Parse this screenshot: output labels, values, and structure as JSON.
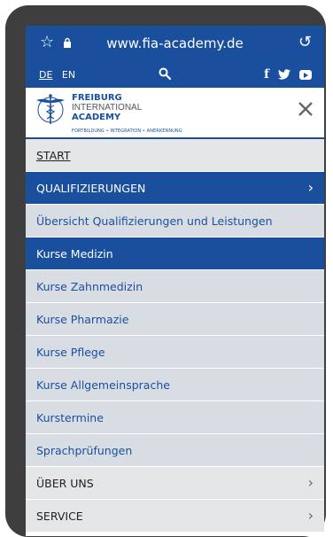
{
  "browser": {
    "url": "www.fia-academy.de",
    "star_icon": "star-icon",
    "lock_icon": "lock-icon",
    "reload_icon": "reload-icon"
  },
  "topnav": {
    "languages": [
      {
        "label": "DE",
        "active": true
      },
      {
        "label": "EN",
        "active": false
      }
    ],
    "search_icon": "search-icon",
    "social": [
      "facebook-icon",
      "twitter-icon",
      "youtube-icon"
    ]
  },
  "logo": {
    "line1": "FREIBURG",
    "line2": "INTERNATIONAL",
    "line3": "ACADEMY",
    "tagline": "FORTBILDUNG • INTEGRATION • ANERKENNUNG"
  },
  "menu": {
    "start": "START",
    "qualifizierungen": "QUALIFIZIERUNGEN",
    "sub_items": [
      "Übersicht Qualifizierungen und Leistungen",
      "Kurse Medizin",
      "Kurse Zahnmedizin",
      "Kurse Pharmazie",
      "Kurse Pflege",
      "Kurse Allgemeinsprache",
      "Kurstermine",
      "Sprachprüfungen"
    ],
    "ueber_uns": "ÜBER UNS",
    "service": "SERVICE",
    "chevron": "›"
  },
  "colors": {
    "brand_blue": "#1a4f9e",
    "menu_bg": "#e5e6e8",
    "submenu_bg": "#d8dde3",
    "device_frame": "#3e3e3e"
  }
}
